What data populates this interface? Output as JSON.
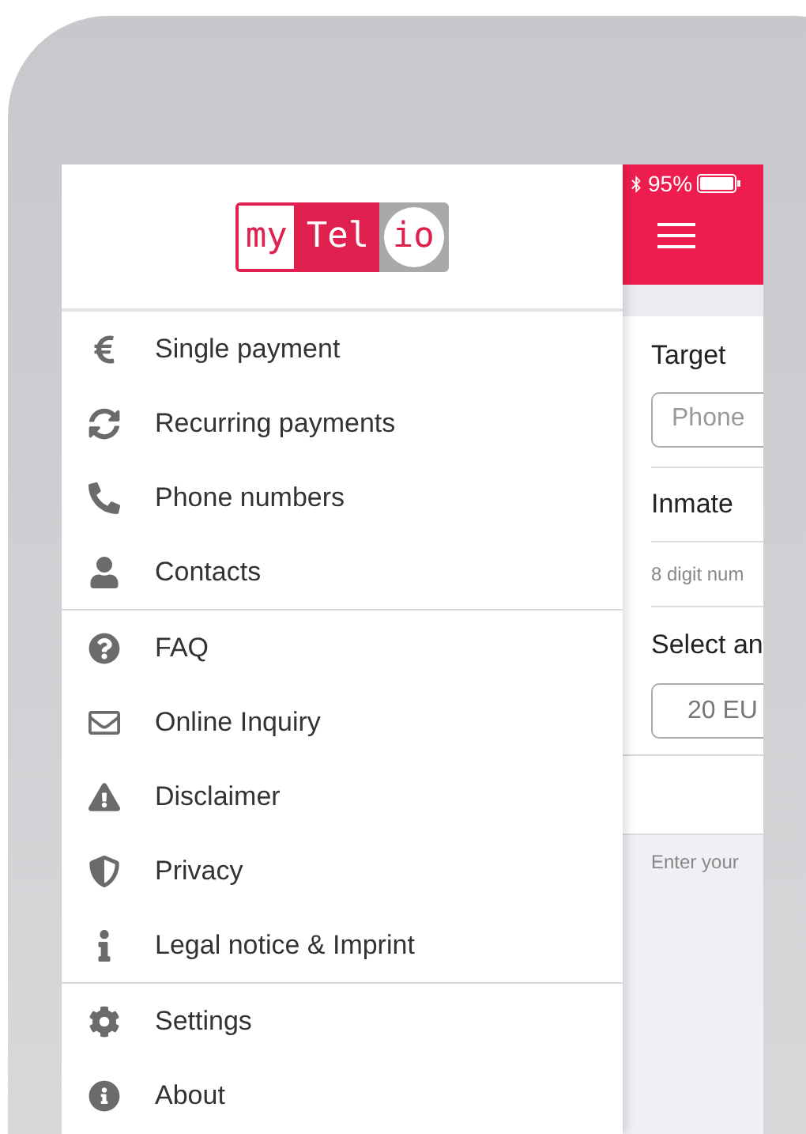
{
  "drawer": {
    "logo": {
      "part_1": "my",
      "part_2": "Tel",
      "part_3": "io"
    },
    "groups": [
      [
        {
          "label": "Single payment",
          "kind": "euro"
        },
        {
          "label": "Recurring payments",
          "kind": "sync"
        },
        {
          "label": "Phone numbers",
          "kind": "phone"
        },
        {
          "label": "Contacts",
          "kind": "user"
        }
      ],
      [
        {
          "label": "FAQ",
          "kind": "question"
        },
        {
          "label": "Online Inquiry",
          "kind": "envelope"
        },
        {
          "label": "Disclaimer",
          "kind": "warning"
        },
        {
          "label": "Privacy",
          "kind": "shield"
        },
        {
          "label": "Legal notice & Imprint",
          "kind": "info"
        }
      ],
      [
        {
          "label": "Settings",
          "kind": "gear"
        },
        {
          "label": "About",
          "kind": "info-circle"
        }
      ]
    ]
  },
  "status_bar": {
    "battery": "95%"
  },
  "form": {
    "target_label": "Target",
    "target_placeholder": "Phone",
    "inmate_label": "Inmate",
    "inmate_hint": "8 digit num",
    "amount_label": "Select an",
    "amount_value": "20 EU",
    "footer_hint": "Enter your"
  }
}
